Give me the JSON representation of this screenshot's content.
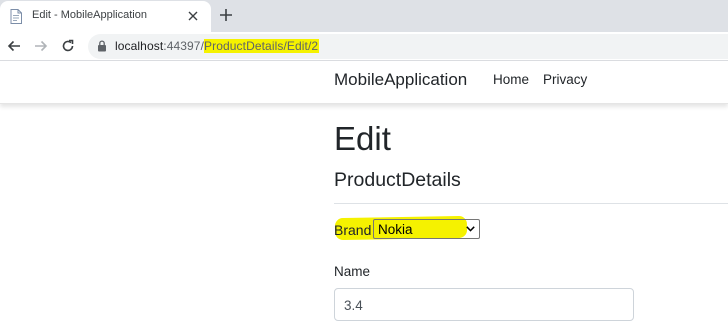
{
  "browser": {
    "tab_title": "Edit - MobileApplication",
    "url_host": "localhost",
    "url_port": ":44397/",
    "url_path": "ProductDetails/Edit/2",
    "highlight_color": "#f5f200"
  },
  "site": {
    "brand": "MobileApplication",
    "nav": [
      {
        "label": "Home"
      },
      {
        "label": "Privacy"
      }
    ]
  },
  "page": {
    "title": "Edit",
    "subtitle": "ProductDetails"
  },
  "form": {
    "brand_label": "Brand",
    "brand_value": "Nokia",
    "name_label": "Name",
    "name_value": "3.4"
  }
}
